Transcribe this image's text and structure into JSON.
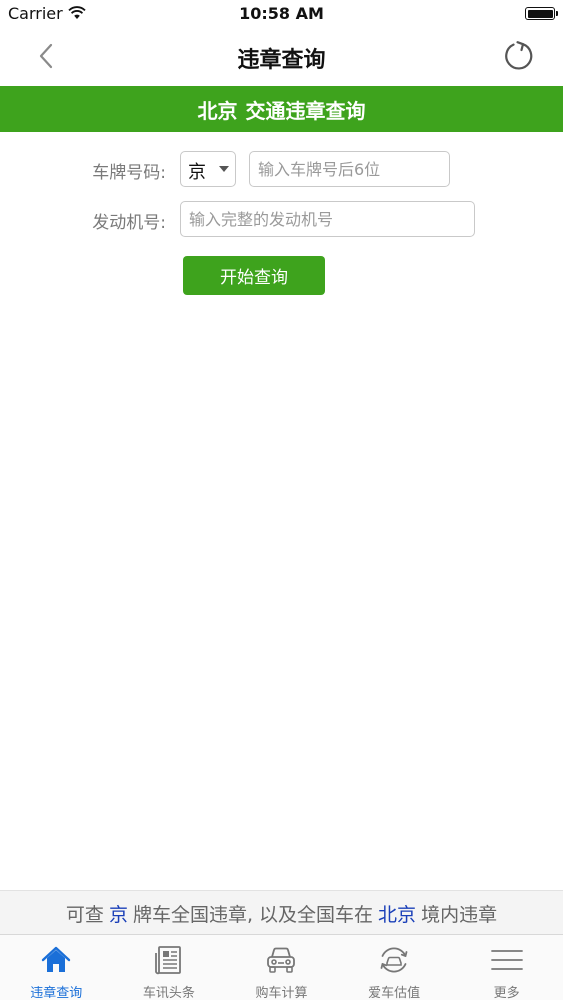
{
  "status_bar": {
    "carrier": "Carrier",
    "time": "10:58 AM"
  },
  "nav": {
    "title": "违章查询",
    "back_icon": "chevron-left-icon",
    "refresh_icon": "refresh-icon"
  },
  "banner": {
    "city": "北京",
    "title": "交通违章查询"
  },
  "form": {
    "plate_label": "车牌号码:",
    "province_value": "京",
    "plate_placeholder": "输入车牌号后6位",
    "engine_label": "发动机号:",
    "engine_placeholder": "输入完整的发动机号",
    "submit_label": "开始查询"
  },
  "info": {
    "prefix": "可查",
    "plate_prefix": "京",
    "middle": "牌车全国违章, 以及全国车在",
    "city": "北京",
    "suffix": "境内违章"
  },
  "tabs": [
    {
      "label": "违章查询",
      "icon": "home-icon",
      "active": true
    },
    {
      "label": "车讯头条",
      "icon": "newspaper-icon",
      "active": false
    },
    {
      "label": "购车计算",
      "icon": "car-icon",
      "active": false
    },
    {
      "label": "爱车估值",
      "icon": "valuation-icon",
      "active": false
    },
    {
      "label": "更多",
      "icon": "menu-icon",
      "active": false
    }
  ],
  "colors": {
    "accent_green": "#3ea31d",
    "tab_active": "#1a6fd8",
    "highlight_blue": "#1a3fb8"
  }
}
